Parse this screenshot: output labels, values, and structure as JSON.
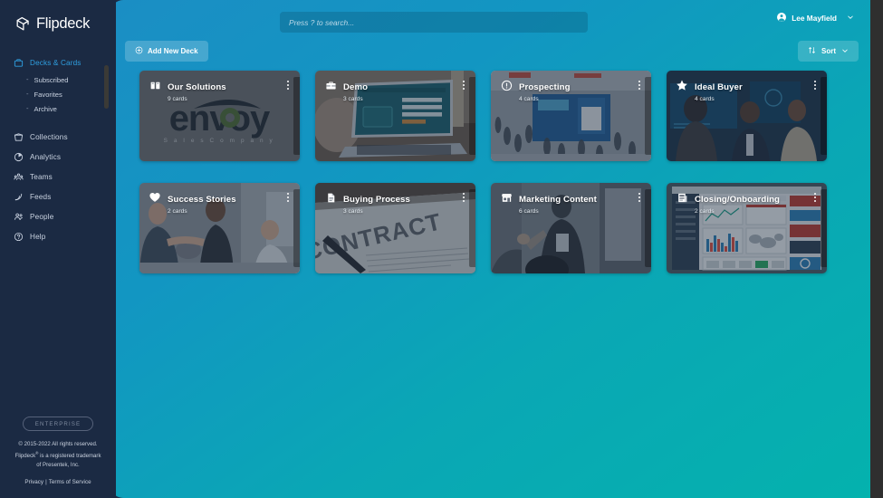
{
  "brand": {
    "name": "Flipdeck",
    "logo_icon": "flipdeck-cards-logo"
  },
  "sidebar": {
    "items": [
      {
        "label": "Decks & Cards",
        "icon": "decks-icon",
        "active": true
      },
      {
        "label": "Collections",
        "icon": "collections-icon",
        "active": false
      },
      {
        "label": "Analytics",
        "icon": "analytics-icon",
        "active": false
      },
      {
        "label": "Teams",
        "icon": "teams-icon",
        "active": false
      },
      {
        "label": "Feeds",
        "icon": "feeds-icon",
        "active": false
      },
      {
        "label": "People",
        "icon": "people-icon",
        "active": false
      },
      {
        "label": "Help",
        "icon": "help-icon",
        "active": false
      }
    ],
    "sub_items": [
      {
        "label": "Subscribed"
      },
      {
        "label": "Favorites"
      },
      {
        "label": "Archive"
      }
    ],
    "footer": {
      "badge": "ENTERPRISE",
      "copyright_line1": "© 2015-2022 All rights reserved.",
      "copyright_line2_a": "Flipdeck",
      "copyright_line2_sup": "®",
      "copyright_line2_b": " is a registered trademark",
      "copyright_line3": "of Presentek, Inc.",
      "privacy": "Privacy",
      "separator": "|",
      "terms": "Terms of Service"
    }
  },
  "topbar": {
    "search": {
      "placeholder": "Press ? to search...",
      "value": ""
    },
    "user": {
      "name": "Lee Mayfield",
      "avatar_icon": "user-circle-icon",
      "chevron_icon": "chevron-down-icon"
    }
  },
  "actions": {
    "add_deck": {
      "label": "Add New Deck",
      "icon": "plus-circle-icon"
    },
    "sort": {
      "label": "Sort",
      "icon": "sort-arrows-icon",
      "chevron_icon": "chevron-down-icon"
    }
  },
  "colors": {
    "sidebar_bg": "#1b2a43",
    "accent_blue": "#2f9fe0",
    "gradient_start": "#1b8ec4",
    "gradient_end": "#04b2ad",
    "card_veil": "rgba(30,45,65,0.46)"
  },
  "decks": [
    {
      "title": "Our Solutions",
      "count": "9 cards",
      "icon": "book-icon",
      "art": "envoy-logo"
    },
    {
      "title": "Demo",
      "count": "3 cards",
      "icon": "briefcase-icon",
      "art": "laptop-photo"
    },
    {
      "title": "Prospecting",
      "count": "4 cards",
      "icon": "exclamation-circle-icon",
      "art": "tradeshow-photo"
    },
    {
      "title": "Ideal Buyer",
      "count": "4 cards",
      "icon": "star-icon",
      "art": "meeting-photo"
    },
    {
      "title": "Success Stories",
      "count": "2 cards",
      "icon": "heart-icon",
      "art": "handshake-photo"
    },
    {
      "title": "Buying Process",
      "count": "3 cards",
      "icon": "file-icon",
      "art": "contract-photo"
    },
    {
      "title": "Marketing Content",
      "count": "6 cards",
      "icon": "store-icon",
      "art": "speaker-photo"
    },
    {
      "title": "Closing/Onboarding",
      "count": "2 cards",
      "icon": "newspaper-icon",
      "art": "dashboard-screenshot"
    }
  ],
  "envoy_art": {
    "wordmark": "envoy",
    "tagline": "S a l e s   C o m p a n y"
  },
  "contract_art": {
    "word": "CONTRACT"
  }
}
